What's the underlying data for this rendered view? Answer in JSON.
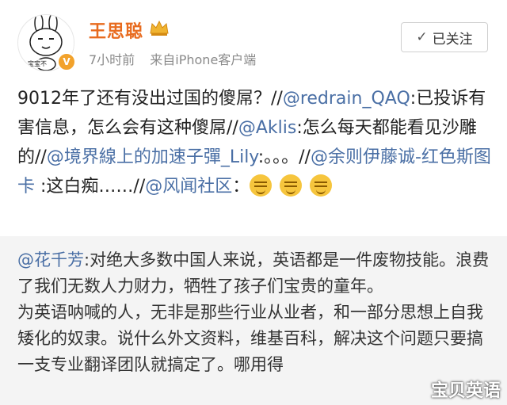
{
  "user": {
    "name": "王思聪",
    "avatar_caption": "宝宝不",
    "vip_mark": "V",
    "time": "7小时前",
    "source": "来自iPhone客户端"
  },
  "follow_button": {
    "check": "✓",
    "label": "已关注"
  },
  "post": {
    "seg1": "9012年了还有没出过国的傻屌？//",
    "mention1": "@redrain_QAQ",
    "seg2": ":已投诉有害信息，怎么会有这种傻屌//",
    "mention2": "@Aklis",
    "seg3": ":怎么每天都能看见沙雕的//",
    "mention3": "@境界線上的加速子彈_Lily",
    "seg4": ":。。。//",
    "mention4": "@余则伊藤诚-红色斯图卡",
    "seg5": " :这白痴……//",
    "mention5": "@风闻社区",
    "seg6": "："
  },
  "repost": {
    "mention": "@花千芳",
    "line1": ":对绝大多数中国人来说，英语都是一件废物技能。浪费了我们无数人力财力，牺牲了孩子们宝贵的童年。",
    "line2": "为英语呐喊的人，无非是那些行业从业者，和一部分思想上自我矮化的奴隶。说什么外文资料，维基百科，解决这个问题只要搞一支专业翻译团队就搞定了。哪用得"
  },
  "watermark": "宝贝英语",
  "colors": {
    "name": "#e86b1f",
    "mention": "#4a6fa5",
    "repost_bg": "#f4f4f4"
  }
}
